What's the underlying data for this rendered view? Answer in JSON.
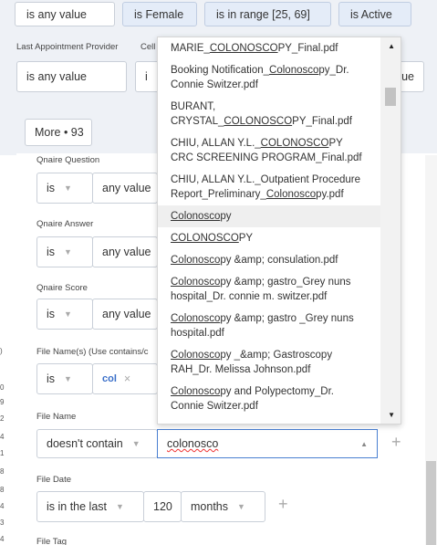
{
  "top_chips": [
    "is any value",
    "is Female",
    "is in range [25, 69]",
    "is Active"
  ],
  "row2": {
    "label_provider": "Last Appointment Provider",
    "label_cell": "Cell",
    "value_left": "is any value",
    "value_left_partial": "i",
    "value_right_partial": "ue"
  },
  "more_button": "More • 93",
  "fields": {
    "qnaire_question": {
      "label": "Qnaire Question",
      "op": "is",
      "value": "any value"
    },
    "qnaire_answer": {
      "label": "Qnaire Answer",
      "op": "is",
      "value": "any value"
    },
    "qnaire_score": {
      "label": "Qnaire Score",
      "op": "is",
      "value": "any value"
    },
    "file_names": {
      "label": "File Name(s) (Use contains/c",
      "op": "is",
      "tag": "col",
      "tag_close": "×"
    },
    "file_name": {
      "label": "File Name",
      "op": "doesn't contain",
      "input": "colonosco"
    },
    "file_date": {
      "label": "File Date",
      "op": "is in the last",
      "number": "120",
      "unit": "months"
    },
    "file_tag": {
      "label": "File Tag"
    }
  },
  "side_numbers": [
    ")",
    "0",
    "9",
    "2",
    "4",
    "1",
    "8",
    "8",
    "4",
    "3",
    "4"
  ],
  "dropdown_items": [
    {
      "pre": "MARIE_",
      "u": "COLONOSCO",
      "post": "PY_Final.pdf"
    },
    {
      "pre": "Booking Notification_",
      "u": "Colonosco",
      "post": "py_Dr. Connie Switzer.pdf"
    },
    {
      "pre": "BURANT, CRYSTAL_",
      "u": "COLONOSCO",
      "post": "PY_Final.pdf"
    },
    {
      "pre": "CHIU, ALLAN Y.L._",
      "u": "COLONOSCO",
      "post": "PY CRC SCREENING PROGRAM_Final.pdf"
    },
    {
      "pre": "CHIU, ALLAN Y.L._Outpatient Procedure Report_Preliminary_",
      "u": "Colonosco",
      "post": "py.pdf"
    },
    {
      "pre": "",
      "u": "Colonosco",
      "post": "py"
    },
    {
      "pre": "",
      "u": "COLONOSCO",
      "post": "PY"
    },
    {
      "pre": "",
      "u": "Colonosco",
      "post": "py &amp; consulation.pdf"
    },
    {
      "pre": "",
      "u": "Colonosco",
      "post": "py &amp; gastro_Grey nuns hospital_Dr. connie m. switzer.pdf"
    },
    {
      "pre": "",
      "u": "Colonosco",
      "post": "py &amp; gastro _Grey nuns hospital.pdf"
    },
    {
      "pre": "",
      "u": "Colonosco",
      "post": "py _&amp; Gastroscopy RAH_Dr. Melissa Johnson.pdf"
    },
    {
      "pre": "",
      "u": "Colonosco",
      "post": "py and Polypectomy_Dr. Connie Switzer.pdf"
    }
  ],
  "plus_sign": "+",
  "caret_up": "▲",
  "caret_down": "▼",
  "caret_small": "▼"
}
